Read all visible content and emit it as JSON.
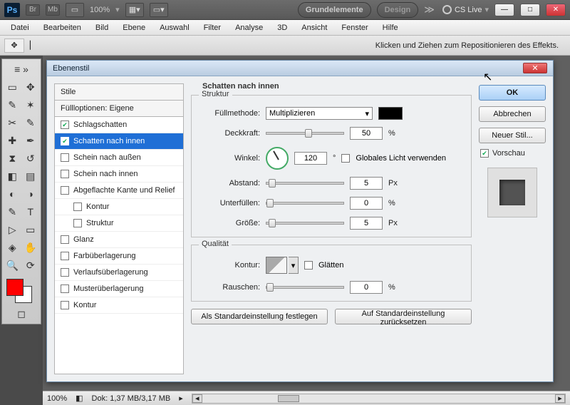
{
  "app": {
    "zoom_label": "100%",
    "workspace_primary": "Grundelemente",
    "workspace_secondary": "Design",
    "cslive": "CS Live",
    "mini1": "Br",
    "mini2": "Mb"
  },
  "menu": {
    "datei": "Datei",
    "bearbeiten": "Bearbeiten",
    "bild": "Bild",
    "ebene": "Ebene",
    "auswahl": "Auswahl",
    "filter": "Filter",
    "analyse": "Analyse",
    "3d": "3D",
    "ansicht": "Ansicht",
    "fenster": "Fenster",
    "hilfe": "Hilfe"
  },
  "options_hint": "Klicken und Ziehen zum Repositionieren des Effekts.",
  "status": {
    "zoom": "100%",
    "doc": "Dok: 1,37 MB/3,17 MB"
  },
  "dialog": {
    "title": "Ebenenstil",
    "ok": "OK",
    "cancel": "Abbrechen",
    "newstyle": "Neuer Stil...",
    "preview": "Vorschau",
    "make_default": "Als Standardeinstellung festlegen",
    "reset_default": "Auf Standardeinstellung zurücksetzen",
    "styles_header": "Stile",
    "fill_options": "Füllloptionen: Eigene",
    "section_title": "Schatten nach innen",
    "items": {
      "schlagschatten": "Schlagschatten",
      "schatten_innen": "Schatten nach innen",
      "schein_aussen": "Schein nach außen",
      "schein_innen": "Schein nach innen",
      "bevel": "Abgeflachte Kante und Relief",
      "kontur": "Kontur",
      "struktur": "Struktur",
      "glanz": "Glanz",
      "farbueber": "Farbüberlagerung",
      "verlauf": "Verlaufsüberlagerung",
      "muster": "Musterüberlagerung",
      "kontur2": "Kontur"
    },
    "struktur": {
      "legend": "Struktur",
      "blendmode_label": "Füllmethode:",
      "blendmode_value": "Multiplizieren",
      "opacity_label": "Deckkraft:",
      "opacity_value": "50",
      "angle_label": "Winkel:",
      "angle_value": "120",
      "angle_unit": "°",
      "global_light": "Globales Licht verwenden",
      "distance_label": "Abstand:",
      "distance_value": "5",
      "distance_unit": "Px",
      "choke_label": "Unterfüllen:",
      "choke_value": "0",
      "size_label": "Größe:",
      "size_value": "5",
      "size_unit": "Px",
      "percent": "%"
    },
    "qual": {
      "legend": "Qualität",
      "contour_label": "Kontur:",
      "antialias": "Glätten",
      "noise_label": "Rauschen:",
      "noise_value": "0",
      "percent": "%"
    }
  },
  "colors": {
    "accent": "#1f6fd6",
    "fg": "#ff0000",
    "bg": "#ffffff"
  }
}
